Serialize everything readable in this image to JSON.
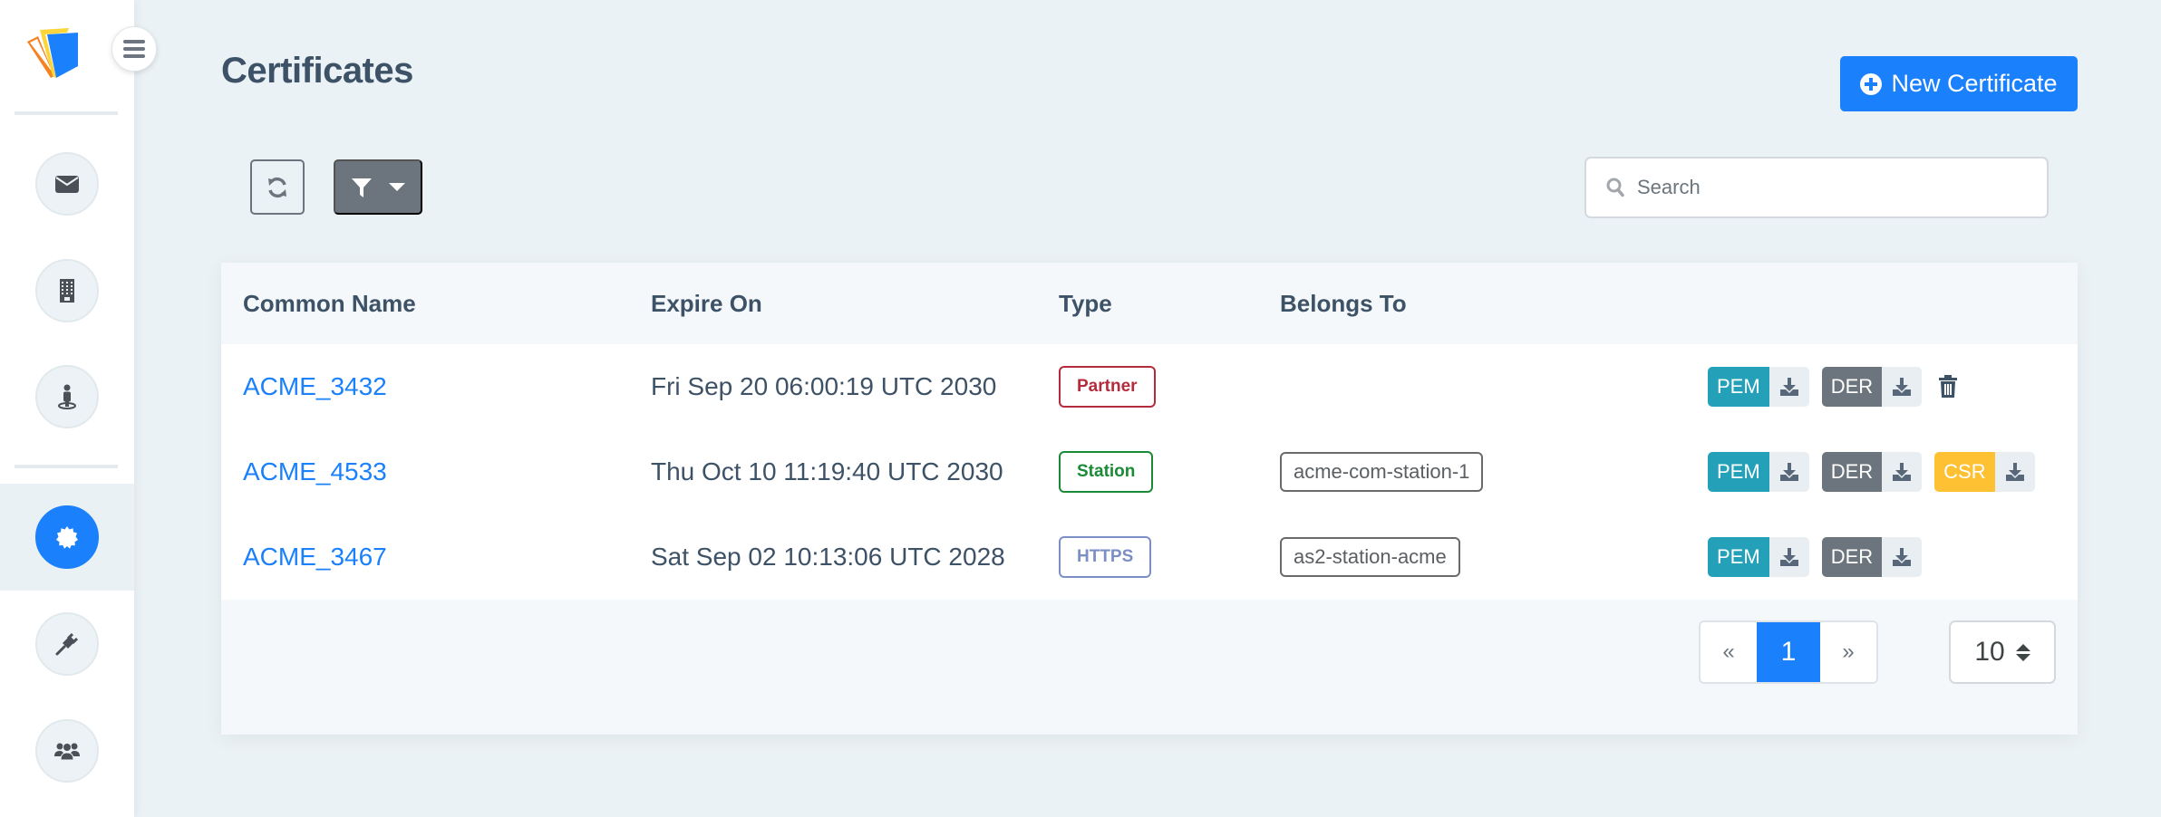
{
  "page": {
    "title": "Certificates"
  },
  "colors": {
    "primary": "#1a80fb",
    "secondary": "#6c757d",
    "pem": "#24a1b8",
    "der": "#6c757d",
    "csr": "#fec134",
    "partner": "#b32b3c",
    "station": "#1b8a36",
    "https": "#7b8fc4"
  },
  "sidebar": {
    "menu_toggle_icon": "hamburger-icon",
    "logo": "app-logo",
    "items": [
      {
        "name": "messages",
        "icon": "envelope-icon",
        "active": false
      },
      {
        "name": "organizations",
        "icon": "building-icon",
        "active": false
      },
      {
        "name": "stations",
        "icon": "person-location-icon",
        "active": false
      },
      {
        "name": "certificates",
        "icon": "certificate-icon",
        "active": true
      },
      {
        "name": "connectors",
        "icon": "plug-icon",
        "active": false
      },
      {
        "name": "users",
        "icon": "users-icon",
        "active": false
      }
    ]
  },
  "toolbar": {
    "new_button_label": "New Certificate",
    "refresh_icon": "refresh-icon",
    "filter_icon": "filter-icon",
    "search_placeholder": "Search",
    "search_value": ""
  },
  "table": {
    "columns": [
      "Common Name",
      "Expire On",
      "Type",
      "Belongs To"
    ],
    "rows": [
      {
        "common_name": "ACME_3432",
        "expire_on": "Fri Sep 20 06:00:19 UTC 2030",
        "type": "Partner",
        "belongs_to": "",
        "downloads": [
          "PEM",
          "DER"
        ],
        "deletable": true
      },
      {
        "common_name": "ACME_4533",
        "expire_on": "Thu Oct 10 11:19:40 UTC 2030",
        "type": "Station",
        "belongs_to": "acme-com-station-1",
        "downloads": [
          "PEM",
          "DER",
          "CSR"
        ],
        "deletable": false
      },
      {
        "common_name": "ACME_3467",
        "expire_on": "Sat Sep 02 10:13:06 UTC 2028",
        "type": "HTTPS",
        "belongs_to": "as2-station-acme",
        "downloads": [
          "PEM",
          "DER"
        ],
        "deletable": false
      }
    ]
  },
  "pagination": {
    "prev_label": "«",
    "next_label": "»",
    "current_page": "1",
    "per_page": "10"
  }
}
